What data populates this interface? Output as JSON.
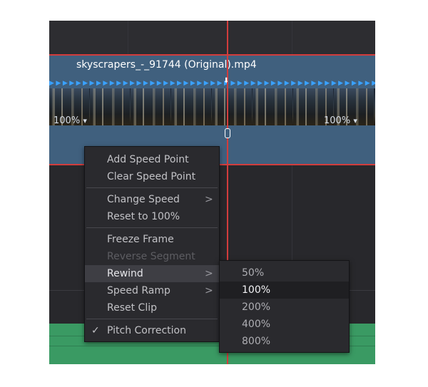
{
  "clip": {
    "name": "skyscrapers_-_91744 (Original).mp4",
    "speed_indicator": "▶▶▶▶▶▶▶▶▶▶▶▶▶▶▶▶▶▶▶▶▶▶▶▶▶▶▶▶▶▶▶▶▶▶▶▶▶▶▶▶▶▶▶▶▶▶▶▶▶▶▶▶▶▶▶▶▶",
    "speed_left": "100%",
    "speed_left_caret": "▾",
    "speed_right": "100%",
    "speed_right_caret": "▾",
    "playhead_marker": "⬇"
  },
  "context_menu": {
    "items": [
      {
        "label": "Add Speed Point"
      },
      {
        "label": "Clear Speed Point"
      },
      {
        "label": "Change Speed",
        "arrow": ">"
      },
      {
        "label": "Reset to 100%"
      },
      {
        "label": "Freeze Frame"
      },
      {
        "label": "Reverse Segment"
      },
      {
        "label": "Rewind",
        "arrow": ">"
      },
      {
        "label": "Speed Ramp",
        "arrow": ">"
      },
      {
        "label": "Reset Clip"
      },
      {
        "label": "Pitch Correction",
        "check": "✓"
      }
    ]
  },
  "rewind_submenu": {
    "items": [
      {
        "label": "50%"
      },
      {
        "label": "100%"
      },
      {
        "label": "200%"
      },
      {
        "label": "400%"
      },
      {
        "label": "800%"
      }
    ]
  },
  "colors": {
    "timeline_bg": "#28282c",
    "clip_bg": "#40607e",
    "playhead": "#d23c3c",
    "speed_arrow": "#3aa2ff",
    "audio_track": "#3a9a63",
    "menu_bg": "#2a2a2e"
  }
}
